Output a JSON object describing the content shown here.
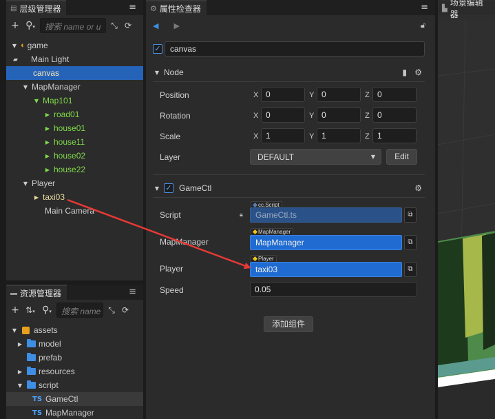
{
  "hierarchy": {
    "tab_label": "层级管理器",
    "menu_glyph": "≡",
    "search_placeholder": "搜索 name or u",
    "nodes": [
      {
        "label": "game"
      },
      {
        "label": "Main Light"
      },
      {
        "label": "canvas"
      },
      {
        "label": "MapManager"
      },
      {
        "label": "Map101"
      },
      {
        "label": "road01"
      },
      {
        "label": "house01"
      },
      {
        "label": "house11"
      },
      {
        "label": "house02"
      },
      {
        "label": "house22"
      },
      {
        "label": "Player"
      },
      {
        "label": "taxi03"
      },
      {
        "label": "Main Camera"
      }
    ]
  },
  "assets": {
    "tab_label": "资源管理器",
    "menu_glyph": "≡",
    "search_placeholder": "搜索 name",
    "items": [
      {
        "label": "assets"
      },
      {
        "label": "model"
      },
      {
        "label": "prefab"
      },
      {
        "label": "resources"
      },
      {
        "label": "script"
      },
      {
        "label": "GameCtl",
        "prefix": "TS"
      },
      {
        "label": "MapManager",
        "prefix": "TS"
      }
    ]
  },
  "inspector": {
    "tab_label": "属性检查器",
    "menu_glyph": "≡",
    "node_name": "canvas",
    "node_section": {
      "title": "Node",
      "position": {
        "label": "Position",
        "x": "0",
        "y": "0",
        "z": "0"
      },
      "rotation": {
        "label": "Rotation",
        "x": "0",
        "y": "0",
        "z": "0"
      },
      "scale": {
        "label": "Scale",
        "x": "1",
        "y": "1",
        "z": "1"
      },
      "layer": {
        "label": "Layer",
        "value": "DEFAULT",
        "edit_label": "Edit"
      },
      "axis_x": "X",
      "axis_y": "Y",
      "axis_z": "Z"
    },
    "component": {
      "title": "GameCtl",
      "script": {
        "label": "Script",
        "tag": "cc.Script",
        "value": "GameCtl.ts"
      },
      "map_manager": {
        "label": "MapManager",
        "tag": "MapManager",
        "value": "MapManager"
      },
      "player": {
        "label": "Player",
        "tag": "Player",
        "value": "taxi03"
      },
      "speed": {
        "label": "Speed",
        "value": "0.05"
      }
    },
    "add_component_label": "添加组件"
  },
  "scene": {
    "tab_label": "场景编辑器"
  },
  "colors": {
    "selection": "#2563b9",
    "node_green": "#7fd94a",
    "annotation_arrow": "#e53935",
    "ref_field": "#1f6bd1"
  }
}
